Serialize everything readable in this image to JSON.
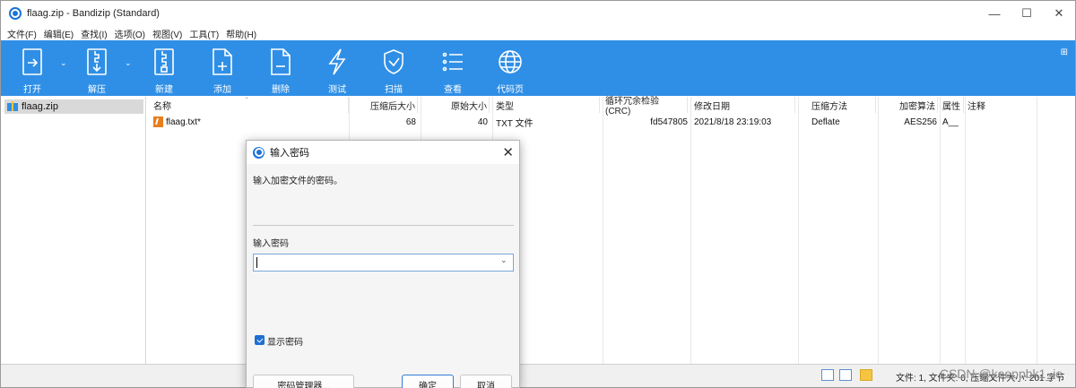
{
  "window": {
    "title": "flaag.zip - Bandizip (Standard)",
    "controls": [
      "—",
      "☐",
      "✕"
    ]
  },
  "menu": [
    "文件(F)",
    "编辑(E)",
    "查找(I)",
    "选项(O)",
    "视图(V)",
    "工具(T)",
    "帮助(H)"
  ],
  "toolbar": {
    "color": "#2f8fe6",
    "items": [
      {
        "label": "打开",
        "icon": "open-icon"
      },
      {
        "label": "解压",
        "icon": "extract-icon"
      },
      {
        "label": "新建",
        "icon": "new-archive-icon"
      },
      {
        "label": "添加",
        "icon": "add-icon"
      },
      {
        "label": "删除",
        "icon": "delete-icon"
      },
      {
        "label": "测试",
        "icon": "test-icon"
      },
      {
        "label": "扫描",
        "icon": "scan-icon"
      },
      {
        "label": "查看",
        "icon": "view-icon"
      },
      {
        "label": "代码页",
        "icon": "codepage-icon"
      }
    ],
    "dropdown_arrow": "⌄",
    "corner": "⊞"
  },
  "sidebar": {
    "items": [
      {
        "label": "flaag.zip",
        "icon": "zip-icon"
      }
    ]
  },
  "table": {
    "columns": [
      "名称",
      "压缩后大小",
      "原始大小",
      "类型",
      "循环冗余检验 (CRC)",
      "修改日期",
      "压缩方法",
      "加密算法",
      "属性",
      "注释"
    ],
    "rows": [
      {
        "name": "flaag.txt*",
        "compressed": "68",
        "original": "40",
        "type": "TXT 文件",
        "crc": "fd547805",
        "modified": "2021/8/18 23:19:03",
        "method": "Deflate",
        "encryption": "AES256",
        "attr": "A__",
        "comment": ""
      }
    ],
    "sort_indicator": "ˇ"
  },
  "status": {
    "text": "文件: 1, 文件夹: 0, 压缩文件大小: 201 字节",
    "watermark": "CSDN @keeppbk1_ie"
  },
  "dialog": {
    "title": "输入密码",
    "description": "输入加密文件的密码。",
    "field_label": "输入密码",
    "password_value": "",
    "show_password_label": "显示密码",
    "show_password_checked": true,
    "buttons": {
      "manager": "密码管理器...",
      "ok": "确定",
      "cancel": "取消"
    },
    "close": "✕",
    "dropdown": "⌄"
  }
}
